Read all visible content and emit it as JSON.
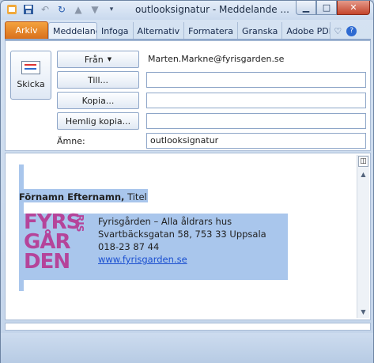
{
  "window": {
    "title": "outlooksignatur - Meddelande ...",
    "qat_icons": [
      "save-icon",
      "undo-icon",
      "redo-icon",
      "up-arrow-icon",
      "down-arrow-icon",
      "customize-icon"
    ]
  },
  "ribbon": {
    "tabs": [
      {
        "label": "Arkiv"
      },
      {
        "label": "Meddelande"
      },
      {
        "label": "Infoga"
      },
      {
        "label": "Alternativ"
      },
      {
        "label": "Formatera"
      },
      {
        "label": "Granska"
      },
      {
        "label": "Adobe PDF"
      }
    ]
  },
  "header": {
    "send_label": "Skicka",
    "from_label": "Från",
    "from_value": "Marten.Markne@fyrisgarden.se",
    "to_label": "Till...",
    "cc_label": "Kopia...",
    "bcc_label": "Hemlig kopia...",
    "subject_label": "Ämne:",
    "subject_value": "outlooksignatur",
    "to_value": "",
    "cc_value": "",
    "bcc_value": ""
  },
  "signature": {
    "name": "Förnamn Efternamn,",
    "title": "Titel",
    "logo_lines": [
      "FYRS",
      "GÅR",
      "DEN"
    ],
    "logo_vertical": "RIS",
    "company": "Fyrisgården – Alla åldrars hus",
    "address": "Svartbäcksgatan 58, 753 33 Uppsala",
    "phone": "018-23 87 44",
    "url": "www.fyrisgarden.se",
    "logo_color": "#b5449a"
  }
}
